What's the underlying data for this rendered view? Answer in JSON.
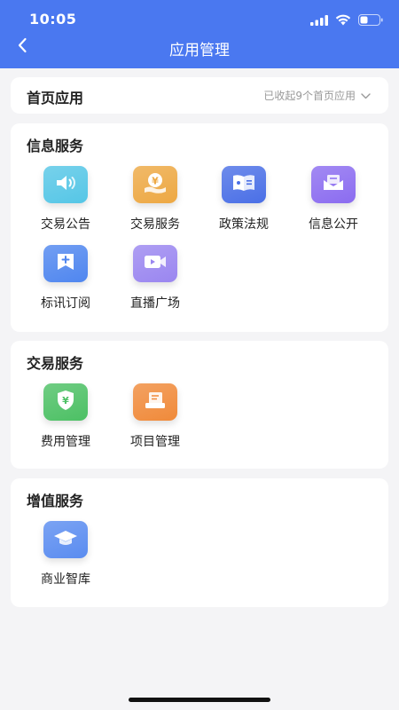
{
  "status": {
    "time": "10:05"
  },
  "nav": {
    "title": "应用管理"
  },
  "home_apps": {
    "title": "首页应用",
    "collapse_text": "已收起9个首页应用"
  },
  "sections": [
    {
      "title": "信息服务",
      "items": [
        {
          "label": "交易公告",
          "icon": "speaker-icon",
          "color": "#55c6e6"
        },
        {
          "label": "交易服务",
          "icon": "coin-hand-icon",
          "color": "#eda843"
        },
        {
          "label": "政策法规",
          "icon": "book-icon",
          "color": "#4a6fe6"
        },
        {
          "label": "信息公开",
          "icon": "mail-icon",
          "color": "#8b6cf0"
        },
        {
          "label": "标讯订阅",
          "icon": "subscribe-icon",
          "color": "#4f86ef"
        },
        {
          "label": "直播广场",
          "icon": "video-icon",
          "color": "#9a86f0"
        }
      ]
    },
    {
      "title": "交易服务",
      "items": [
        {
          "label": "费用管理",
          "icon": "yuan-shield-icon",
          "color": "#4cc064"
        },
        {
          "label": "项目管理",
          "icon": "project-icon",
          "color": "#f08a3a"
        }
      ]
    },
    {
      "title": "增值服务",
      "items": [
        {
          "label": "商业智库",
          "icon": "graduation-cap-icon",
          "color": "#5a8cf0"
        }
      ]
    }
  ]
}
